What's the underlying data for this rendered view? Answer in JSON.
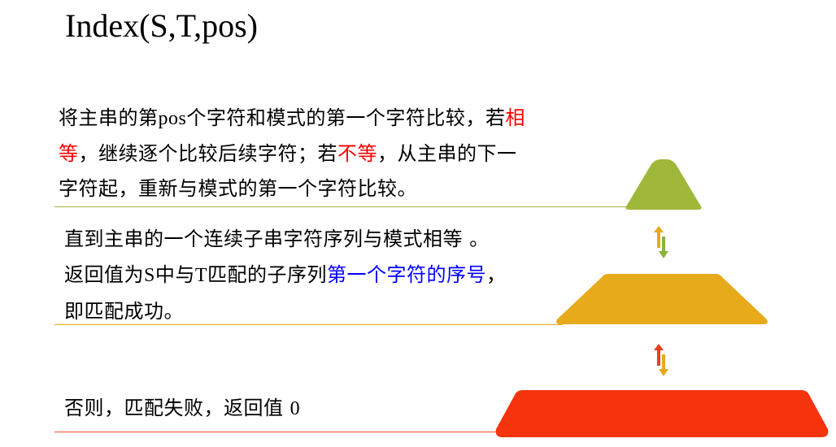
{
  "title": "Index(S,T,pos)",
  "steps": [
    {
      "lines": [
        [
          {
            "text": "将主串的第",
            "color": "#000000",
            "font": "sans"
          },
          {
            "text": "pos",
            "color": "#000000",
            "font": "serif"
          },
          {
            "text": "个字符和模式的第一个字符比较，若",
            "color": "#000000",
            "font": "sans"
          },
          {
            "text": "相",
            "color": "#ff0000",
            "font": "sans"
          }
        ],
        [
          {
            "text": "等",
            "color": "#ff0000",
            "font": "sans"
          },
          {
            "text": "，继续逐个比较后续字符；若",
            "color": "#000000",
            "font": "sans"
          },
          {
            "text": "不等",
            "color": "#ff0000",
            "font": "sans"
          },
          {
            "text": "，从主串的下一",
            "color": "#000000",
            "font": "sans"
          }
        ],
        [
          {
            "text": "字符起，重新与模式的第一个字符比较。",
            "color": "#000000",
            "font": "sans"
          }
        ]
      ]
    },
    {
      "lines": [
        [
          {
            "text": "直到主串的一个连续子串字符序列与模式相等 。",
            "color": "#000000",
            "font": "sans"
          }
        ],
        [
          {
            "text": "返回值为",
            "color": "#000000",
            "font": "sans"
          },
          {
            "text": "S",
            "color": "#000000",
            "font": "serif"
          },
          {
            "text": "中与",
            "color": "#000000",
            "font": "sans"
          },
          {
            "text": "T",
            "color": "#000000",
            "font": "serif"
          },
          {
            "text": "匹配的子序列",
            "color": "#000000",
            "font": "sans"
          },
          {
            "text": "第一个字符的序号",
            "color": "#0000ff",
            "font": "sans"
          },
          {
            "text": "，",
            "color": "#000000",
            "font": "sans"
          }
        ],
        [
          {
            "text": "即匹配成功。",
            "color": "#000000",
            "font": "sans"
          }
        ]
      ]
    },
    {
      "lines": [
        [
          {
            "text": "否则，匹配失败，返回值 ",
            "color": "#000000",
            "font": "sans"
          },
          {
            "text": "0",
            "color": "#000000",
            "font": "serif"
          }
        ]
      ]
    }
  ],
  "colors": {
    "pyramid_top": "#9fb83a",
    "pyramid_middle": "#e6aa1a",
    "pyramid_bottom": "#f5340e",
    "arrow_red": "#e8401c",
    "arrow_gold": "#e6aa1a",
    "arrow_green": "#8cb33a"
  },
  "icons": {
    "connector_top": "up-down-arrows-icon",
    "connector_bottom": "up-down-arrows-icon"
  }
}
